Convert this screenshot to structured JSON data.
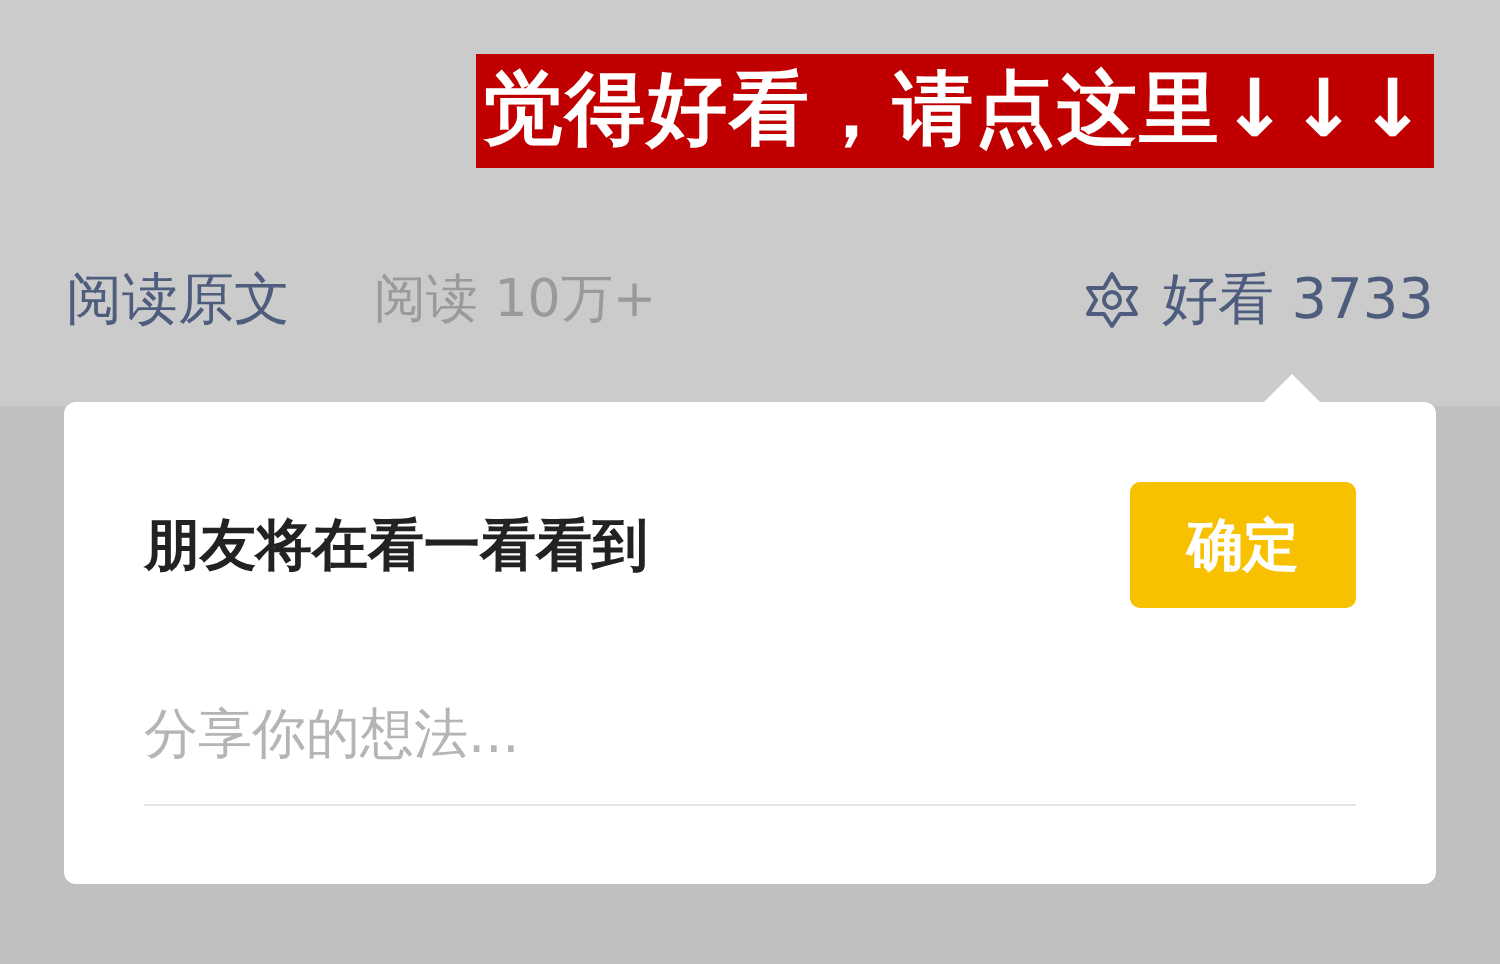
{
  "banner": {
    "text": "觉得好看，请点这里↓↓↓"
  },
  "bottom_bar": {
    "read_original": "阅读原文",
    "read_count": "阅读 10万+",
    "like": "好看 3733"
  },
  "popup": {
    "title": "朋友将在看一看看到",
    "confirm_button": "确定",
    "comment_field": {
      "placeholder": "分享你的想法..."
    }
  }
}
